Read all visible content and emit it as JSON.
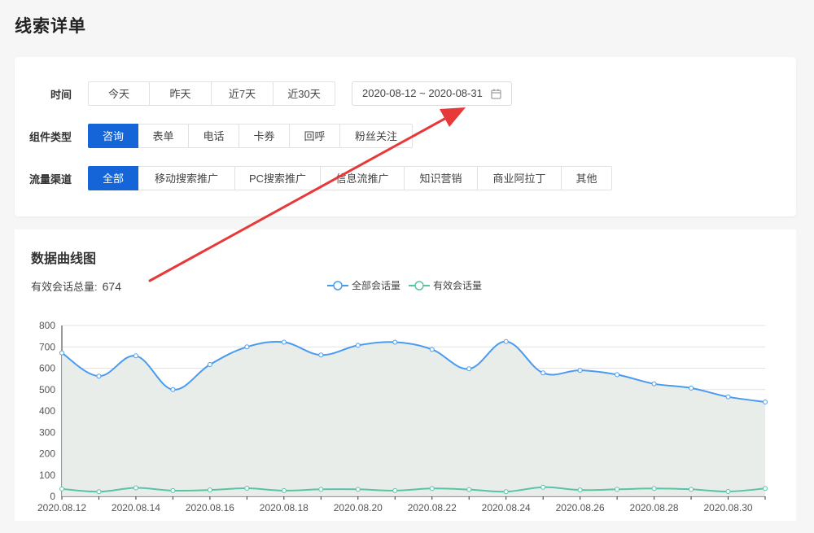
{
  "page": {
    "title": "线索详单"
  },
  "filters": {
    "time": {
      "label": "时间",
      "options": [
        "今天",
        "昨天",
        "近7天",
        "近30天"
      ],
      "date_range": "2020-08-12 ~ 2020-08-31"
    },
    "component": {
      "label": "组件类型",
      "options": [
        "咨询",
        "表单",
        "电话",
        "卡券",
        "回呼",
        "粉丝关注"
      ],
      "active": 0
    },
    "channel": {
      "label": "流量渠道",
      "options": [
        "全部",
        "移动搜索推广",
        "PC搜索推广",
        "信息流推广",
        "知识营销",
        "商业阿拉丁",
        "其他"
      ],
      "active": 0
    }
  },
  "chart_section": {
    "title": "数据曲线图",
    "total_label": "有效会话总量:",
    "total_value": "674"
  },
  "colors": {
    "primary": "#1565d8",
    "series_all": "#4a9bf0",
    "series_valid": "#59c3a6",
    "area_fill": "#e7ebe8",
    "annotation_arrow": "#e8393a"
  },
  "chart_data": {
    "type": "line",
    "x": [
      "2020.08.12",
      "2020.08.13",
      "2020.08.14",
      "2020.08.15",
      "2020.08.16",
      "2020.08.17",
      "2020.08.18",
      "2020.08.19",
      "2020.08.20",
      "2020.08.21",
      "2020.08.22",
      "2020.08.23",
      "2020.08.24",
      "2020.08.25",
      "2020.08.26",
      "2020.08.27",
      "2020.08.28",
      "2020.08.29",
      "2020.08.30",
      "2020.08.31"
    ],
    "x_tick_labels": [
      "2020.08.12",
      "2020.08.14",
      "2020.08.16",
      "2020.08.18",
      "2020.08.20",
      "2020.08.22",
      "2020.08.24",
      "2020.08.26",
      "2020.08.28",
      "2020.08.30"
    ],
    "ylim": [
      0,
      800
    ],
    "yticks": [
      0,
      100,
      200,
      300,
      400,
      500,
      600,
      700,
      800
    ],
    "series": [
      {
        "name": "全部会话量",
        "values": [
          672,
          563,
          658,
          500,
          617,
          700,
          722,
          662,
          707,
          722,
          688,
          597,
          725,
          578,
          590,
          570,
          527,
          507,
          466,
          442
        ]
      },
      {
        "name": "有效会话量",
        "values": [
          35,
          22,
          40,
          27,
          30,
          38,
          27,
          33,
          33,
          27,
          37,
          32,
          22,
          43,
          30,
          33,
          37,
          33,
          23,
          37
        ]
      }
    ],
    "legend_position": "top-center",
    "grid": true
  }
}
